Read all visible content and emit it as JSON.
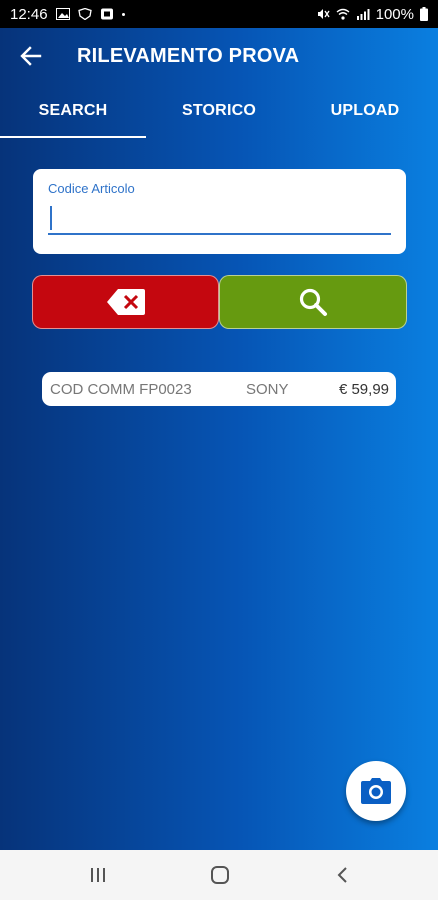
{
  "status_bar": {
    "time": "12:46",
    "battery": "100%"
  },
  "app_bar": {
    "title": "RILEVAMENTO PROVA"
  },
  "tabs": [
    {
      "label": "SEARCH",
      "active": true
    },
    {
      "label": "STORICO",
      "active": false
    },
    {
      "label": "UPLOAD",
      "active": false
    }
  ],
  "search_field": {
    "label": "Codice Articolo",
    "value": ""
  },
  "colors": {
    "clear_button": "#c4070f",
    "search_button": "#669a10",
    "accent": "#2f73c9"
  },
  "results": [
    {
      "code": "COD COMM FP0023",
      "brand": "SONY",
      "price": "€ 59,99"
    }
  ],
  "icons": {
    "back": "arrow-left-icon",
    "clear": "backspace-x-icon",
    "search": "magnifier-icon",
    "camera": "camera-icon",
    "nav_recents": "recents-icon",
    "nav_home": "home-icon",
    "nav_back": "back-chevron-icon"
  }
}
